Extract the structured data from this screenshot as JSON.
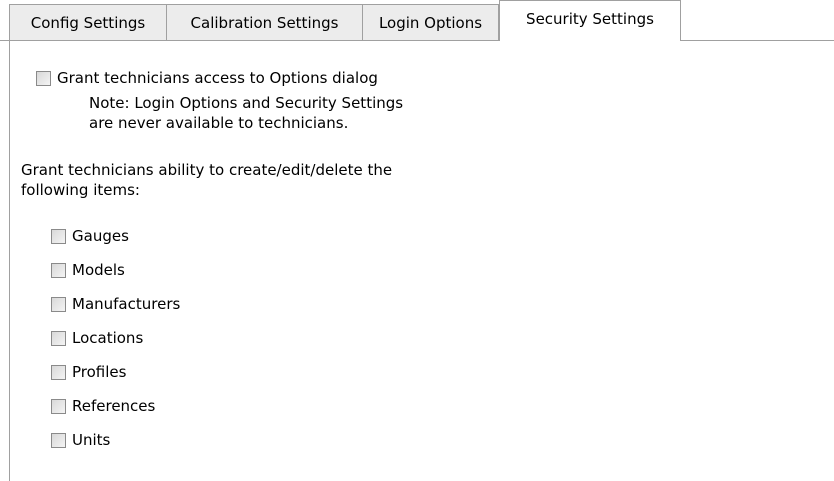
{
  "tabs": [
    {
      "label": "Config Settings",
      "active": false
    },
    {
      "label": "Calibration Settings",
      "active": false
    },
    {
      "label": "Login Options",
      "active": false
    },
    {
      "label": "Security Settings",
      "active": true
    }
  ],
  "security": {
    "grant_options_label": "Grant technicians access to Options dialog",
    "grant_options_checked": false,
    "note_line1": "Note: Login Options and Security Settings",
    "note_line2": "are never available to technicians.",
    "items_intro_line1": "Grant technicians ability to create/edit/delete the",
    "items_intro_line2": "following items:",
    "items": [
      {
        "label": "Gauges",
        "checked": false
      },
      {
        "label": "Models",
        "checked": false
      },
      {
        "label": "Manufacturers",
        "checked": false
      },
      {
        "label": "Locations",
        "checked": false
      },
      {
        "label": "Profiles",
        "checked": false
      },
      {
        "label": "References",
        "checked": false
      },
      {
        "label": "Units",
        "checked": false
      }
    ]
  }
}
